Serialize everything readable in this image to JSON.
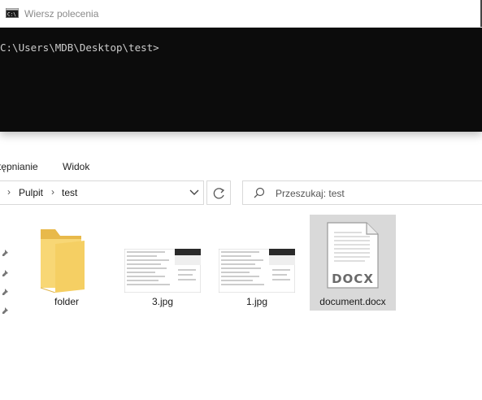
{
  "cmd_window": {
    "title": "Wiersz polecenia",
    "prompt_line": "C:\\Users\\MDB\\Desktop\\test>"
  },
  "explorer": {
    "ribbon_tabs": [
      "tępnianie",
      "Widok"
    ],
    "address": {
      "crumbs": [
        "Pulpit",
        "test"
      ]
    },
    "search": {
      "placeholder": "Przeszukaj: test"
    },
    "files": [
      {
        "name": "folder",
        "icon": "folder-icon"
      },
      {
        "name": "3.jpg",
        "icon": "image-thumbnail"
      },
      {
        "name": "1.jpg",
        "icon": "image-thumbnail"
      },
      {
        "name": "document.docx",
        "icon": "docx-file-icon",
        "badge": "DOCX",
        "selected": true
      }
    ]
  },
  "colors": {
    "console_bg": "#0c0c0c",
    "console_text": "#cccccc",
    "folder_yellow": "#f8d775",
    "selection": "#d9d9d9"
  }
}
